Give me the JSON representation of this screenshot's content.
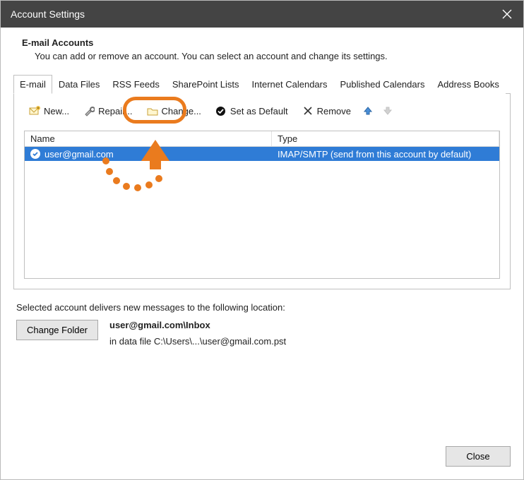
{
  "window": {
    "title": "Account Settings"
  },
  "header": {
    "title": "E-mail Accounts",
    "subtitle": "You can add or remove an account. You can select an account and change its settings."
  },
  "tabs": [
    {
      "label": "E-mail",
      "active": true
    },
    {
      "label": "Data Files"
    },
    {
      "label": "RSS Feeds"
    },
    {
      "label": "SharePoint Lists"
    },
    {
      "label": "Internet Calendars"
    },
    {
      "label": "Published Calendars"
    },
    {
      "label": "Address Books"
    }
  ],
  "toolbar": {
    "new_label": "New...",
    "repair_label": "Repair...",
    "change_label": "Change...",
    "set_default_label": "Set as Default",
    "remove_label": "Remove"
  },
  "grid": {
    "columns": {
      "name": "Name",
      "type": "Type"
    },
    "rows": [
      {
        "name": "user@gmail.com",
        "type": "IMAP/SMTP (send from this account by default)",
        "selected": true,
        "is_default": true
      }
    ]
  },
  "delivery": {
    "caption": "Selected account delivers new messages to the following location:",
    "change_folder_label": "Change Folder",
    "location_main": "user@gmail.com\\Inbox",
    "location_sub": "in data file C:\\Users\\...\\user@gmail.com.pst"
  },
  "footer": {
    "close_label": "Close"
  },
  "annotation": {
    "highlight_color": "#ea7b1e"
  }
}
